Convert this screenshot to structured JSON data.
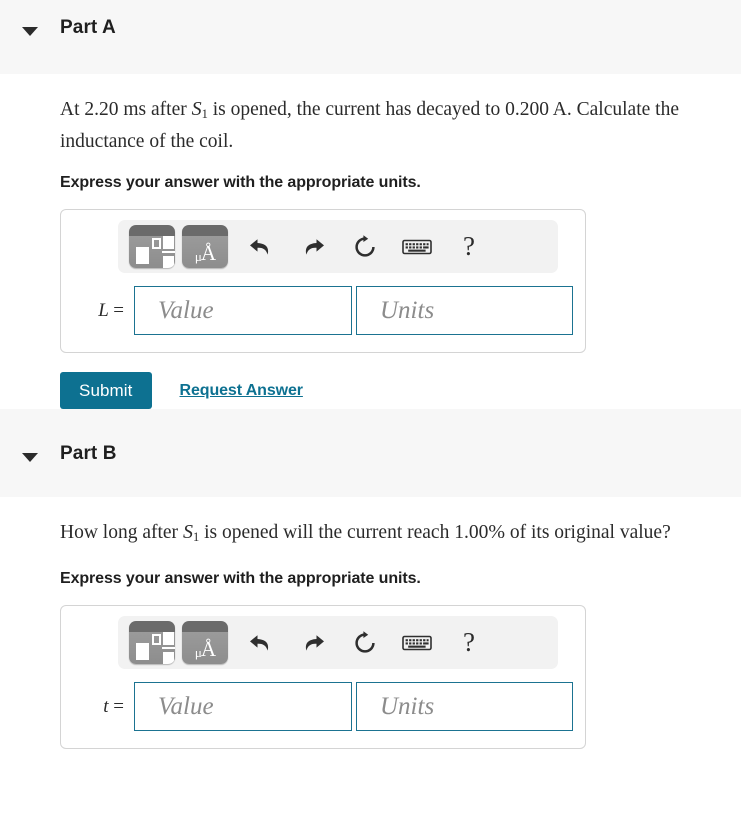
{
  "parts": [
    {
      "id": "a",
      "caret_icon": "chevron-down-icon",
      "title": "Part A",
      "question_pre": "At 2.20 ",
      "question_unit1": "ms",
      "question_mid": " after ",
      "question_var": "S",
      "question_var_sub": "1",
      "question_post": " is opened, the current has decayed to 0.200 ",
      "question_unit2": "A",
      "question_tail": ". Calculate the inductance of the coil.",
      "express": "Express your answer with the appropriate units.",
      "toolbar": {
        "template_icon": "math-template-icon",
        "units_icon": "units-micro-angstrom-icon",
        "units_glyph_mu": "μ",
        "units_glyph_a": "Å",
        "undo_icon": "undo-arrow-icon",
        "redo_icon": "redo-arrow-icon",
        "reset_icon": "reset-circular-arrow-icon",
        "keyboard_icon": "keyboard-icon",
        "help_icon": "question-mark-icon",
        "help_label": "?"
      },
      "variable": "L",
      "equals": "=",
      "value_placeholder": "Value",
      "units_placeholder": "Units",
      "value_current": "",
      "units_current": "",
      "submit_label": "Submit",
      "request_label": "Request Answer",
      "has_actions": true
    },
    {
      "id": "b",
      "caret_icon": "chevron-down-icon",
      "title": "Part B",
      "question_pre": "How long after ",
      "question_unit1": "",
      "question_mid": "",
      "question_var": "S",
      "question_var_sub": "1",
      "question_post": " is opened will the current reach 1.00",
      "question_unit2": "%",
      "question_tail": " of its original value?",
      "express": "Express your answer with the appropriate units.",
      "toolbar": {
        "template_icon": "math-template-icon",
        "units_icon": "units-micro-angstrom-icon",
        "units_glyph_mu": "μ",
        "units_glyph_a": "Å",
        "undo_icon": "undo-arrow-icon",
        "redo_icon": "redo-arrow-icon",
        "reset_icon": "reset-circular-arrow-icon",
        "keyboard_icon": "keyboard-icon",
        "help_icon": "question-mark-icon",
        "help_label": "?"
      },
      "variable": "t",
      "equals": "=",
      "value_placeholder": "Value",
      "units_placeholder": "Units",
      "value_current": "",
      "units_current": "",
      "submit_label": "",
      "request_label": "",
      "has_actions": false
    }
  ],
  "colors": {
    "accent": "#0d7191",
    "field_border": "#1b7391",
    "header_band": "#f7f7f7",
    "panel_border": "#d4d4d4",
    "toolbar_bg": "#f2f2f2",
    "text": "#262626",
    "placeholder": "#8c8c8c"
  }
}
